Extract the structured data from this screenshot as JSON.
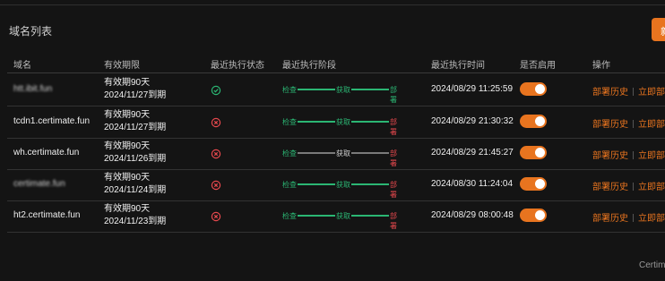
{
  "page": {
    "title": "域名列表",
    "primary_button_label": "新",
    "footer_text": "Certimate"
  },
  "table": {
    "headers": {
      "domain": "域名",
      "validity": "有效期限",
      "status": "最近执行状态",
      "stage": "最近执行阶段",
      "time": "最近执行时间",
      "enabled": "是否启用",
      "actions": "操作"
    },
    "stage_labels": {
      "check": "检查",
      "apply": "获取",
      "deploy": "部署"
    },
    "action_labels": {
      "history": "部署历史",
      "deploy_now": "立即部署"
    },
    "rows": [
      {
        "domain": "htt.ibit.fun",
        "blurred": true,
        "validity_line1": "有效期90天",
        "validity_line2": "2024/11/27到期",
        "status": "success",
        "stages": [
          "success",
          "success",
          "success"
        ],
        "time": "2024/08/29 11:25:59",
        "enabled": true
      },
      {
        "domain": "tcdn1.certimate.fun",
        "blurred": false,
        "validity_line1": "有效期90天",
        "validity_line2": "2024/11/27到期",
        "status": "error",
        "stages": [
          "success",
          "success",
          "error"
        ],
        "time": "2024/08/29 21:30:32",
        "enabled": true
      },
      {
        "domain": "wh.certimate.fun",
        "blurred": false,
        "validity_line1": "有效期90天",
        "validity_line2": "2024/11/26到期",
        "status": "error",
        "stages": [
          "success",
          "pending",
          "error"
        ],
        "time": "2024/08/29 21:45:27",
        "enabled": true
      },
      {
        "domain": "certimate.fun",
        "blurred": true,
        "validity_line1": "有效期90天",
        "validity_line2": "2024/11/24到期",
        "status": "error",
        "stages": [
          "success",
          "success",
          "error"
        ],
        "time": "2024/08/30 11:24:04",
        "enabled": true
      },
      {
        "domain": "ht2.certimate.fun",
        "blurred": false,
        "validity_line1": "有效期90天",
        "validity_line2": "2024/11/23到期",
        "status": "error",
        "stages": [
          "success",
          "success",
          "error"
        ],
        "time": "2024/08/29 08:00:48",
        "enabled": true
      }
    ]
  },
  "colors": {
    "accent": "#e8741f",
    "success": "#2bb673",
    "error": "#e5484d",
    "pending": "#7a7a7a"
  },
  "icons": {
    "success": "check-circle-icon",
    "error": "x-circle-icon"
  }
}
